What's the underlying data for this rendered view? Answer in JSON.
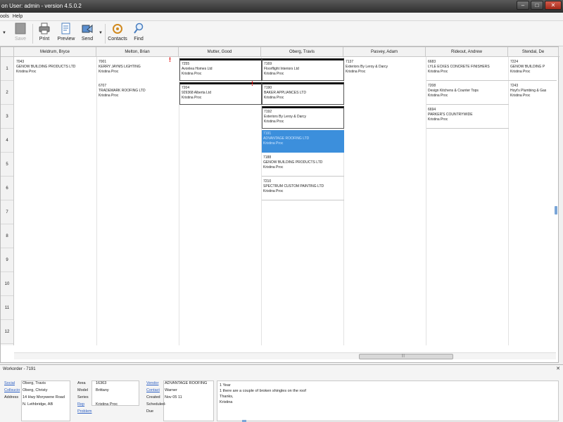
{
  "window": {
    "title": "on User: admin  -  version 4.5.0.2",
    "buttons": {
      "minimize": "–",
      "maximize": "□",
      "close": "✕"
    }
  },
  "menu": [
    "ools",
    "Help"
  ],
  "toolbar": {
    "save": "Save",
    "print": "Print",
    "preview": "Preview",
    "send": "Send",
    "contacts": "Contacts",
    "find": "Find"
  },
  "columns": [
    "Meldrum, Bryce",
    "Melton, Brian",
    "Mutter, Good",
    "Oberg, Travis",
    "Pasvey, Adam",
    "Rideout, Andrew",
    "Stendal, De"
  ],
  "rows": [
    "1",
    "2",
    "3",
    "4",
    "5",
    "6",
    "7",
    "8",
    "9",
    "10",
    "11",
    "12"
  ],
  "cards": [
    {
      "col": 0,
      "row": 0,
      "id": "7043",
      "name": "GENOW BUILDING PRODUCTS LTD",
      "person": "Kristina Proc",
      "style": "plain"
    },
    {
      "col": 1,
      "row": 0,
      "id": "7001",
      "name": "KERRY JAYMS LIGHTING",
      "person": "Kristina Proc",
      "style": "plain",
      "flag": "!"
    },
    {
      "col": 2,
      "row": 0,
      "id": "7255",
      "name": "Avonlea Homes Ltd",
      "person": "Kristina Proc",
      "style": "boxed"
    },
    {
      "col": 3,
      "row": 0,
      "id": "7169",
      "name": "Floorflight Interiors Ltd",
      "person": "Kristina Proc",
      "style": "boxed"
    },
    {
      "col": 4,
      "row": 0,
      "id": "7137",
      "name": "Exteriors By Leroy & Darcy",
      "person": "Kristina Proc",
      "style": "plain"
    },
    {
      "col": 5,
      "row": 0,
      "id": "6683",
      "name": "LYLE ECKES CONCRETE FINISHERS",
      "person": "Kristina Proc",
      "style": "underline"
    },
    {
      "col": 6,
      "row": 0,
      "id": "7224",
      "name": "GENOW BUILDING P",
      "person": "Kristina Proc",
      "style": "underline"
    },
    {
      "col": 1,
      "row": 1,
      "id": "6707",
      "name": "TRADEMARK ROOFING LTD",
      "person": "Kristina Proc",
      "style": "plain"
    },
    {
      "col": 2,
      "row": 1,
      "id": "7204",
      "name": "929368 Alberta Ltd",
      "person": "Kristina Proc",
      "style": "boxed",
      "flag": "!"
    },
    {
      "col": 3,
      "row": 1,
      "id": "7190",
      "name": "BAKER APPLIANCES LTD",
      "person": "Kristina Proc",
      "style": "boxed"
    },
    {
      "col": 5,
      "row": 1,
      "id": "7208",
      "name": "Design Kitchens & Counter Tops",
      "person": "Kristina Proc",
      "style": "underline"
    },
    {
      "col": 6,
      "row": 1,
      "id": "7243",
      "name": "Hoyt's Plumbing & Gas",
      "person": "Kristina Proc",
      "style": "plain"
    },
    {
      "col": 3,
      "row": 2,
      "id": "7192",
      "name": "Exteriors By Leroy & Darcy",
      "person": "Kristina Proc",
      "style": "boxed"
    },
    {
      "col": 5,
      "row": 2,
      "id": "6694",
      "name": "PARKER'S COUNTRYWIDE",
      "person": "Kristina Proc",
      "style": "underline"
    },
    {
      "col": 3,
      "row": 3,
      "id": "7191",
      "name": "ADVANTAGE ROOFING LTD",
      "person": "Kristina Proc",
      "style": "selected"
    },
    {
      "col": 3,
      "row": 4,
      "id": "7188",
      "name": "GENOW BUILDING PRODUCTS LTD",
      "person": "Kristina Proc",
      "style": "underline"
    },
    {
      "col": 3,
      "row": 5,
      "id": "7210",
      "name": "SPECTRUM CUSTOM PAINTING LTD",
      "person": "Kristina Proc",
      "style": "underline"
    }
  ],
  "detail": {
    "title": "Workorder - 7191",
    "close": "✕",
    "left": [
      {
        "label": "Social",
        "value": "Oberg, Travis",
        "link": true
      },
      {
        "label": "Collsucio",
        "value": "Oberg, Christy",
        "link": true
      },
      {
        "label": "Address",
        "value": "14 Hwy Morywene Road",
        "link": false
      },
      {
        "label": "",
        "value": "N. Lethbridge, AB",
        "link": false
      }
    ],
    "mid": [
      {
        "label": "Area",
        "value": "16363"
      },
      {
        "label": "Model",
        "value": "Brittany"
      },
      {
        "label": "Series",
        "value": ""
      },
      {
        "label": "Rep",
        "value": "Kristina Proc",
        "link": true
      },
      {
        "label": "Problem",
        "value": "",
        "link": true
      }
    ],
    "right": [
      {
        "label": "Vendor",
        "value": "ADVANTAGE ROOFING",
        "link": true
      },
      {
        "label": "Contact",
        "value": "Warner",
        "link": true
      },
      {
        "label": "Created",
        "value": "Nov 05 11",
        "link": false
      },
      {
        "label": "Scheduled",
        "value": "-",
        "link": false
      },
      {
        "label": "Due",
        "value": "",
        "link": false
      }
    ],
    "notes": [
      "1 Year",
      "1 there are a couple of broken shingles on the roof",
      "",
      "Thanks,",
      "Kristina"
    ]
  },
  "colors": {
    "selected": "#3c8fdc",
    "flag": "#dd0000",
    "link": "#2c5fc4"
  }
}
